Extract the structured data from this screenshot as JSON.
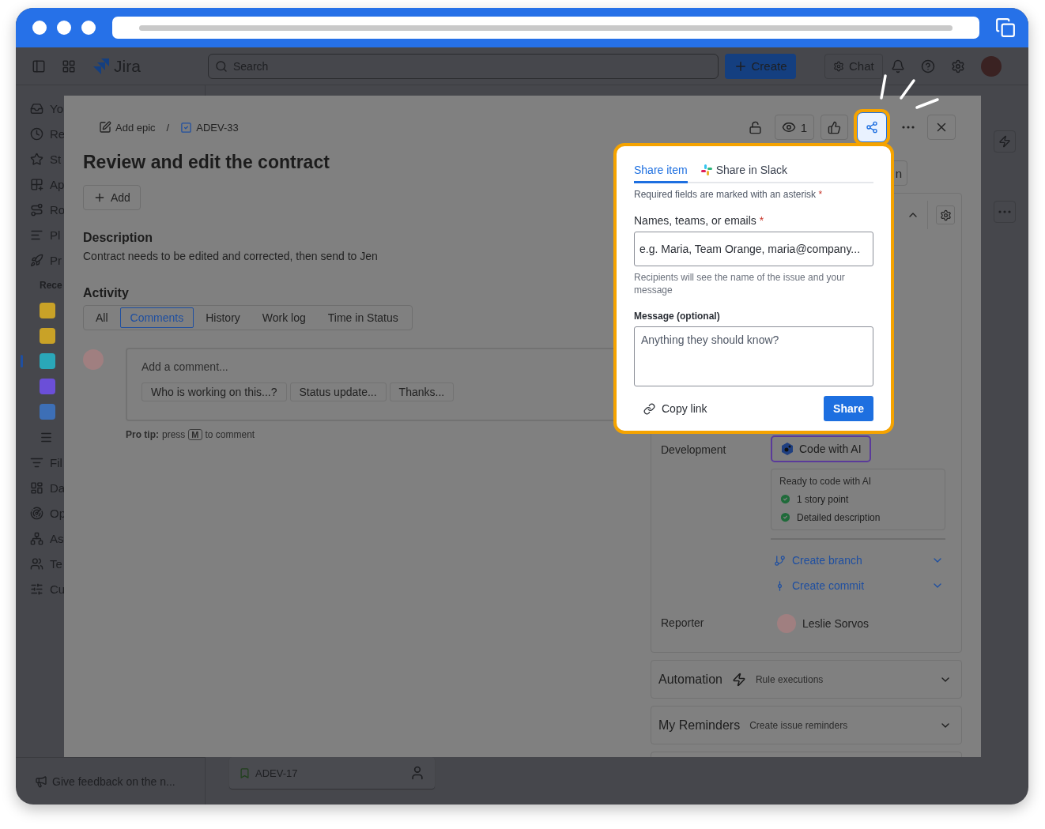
{
  "topbar": {
    "product": "Jira",
    "search_placeholder": "Search",
    "create_label": "Create",
    "chat_label": "Chat"
  },
  "sidebar": {
    "items": [
      {
        "label": "Yo"
      },
      {
        "label": "Re"
      },
      {
        "label": "St"
      },
      {
        "label": "Ap"
      },
      {
        "label": "Ro"
      },
      {
        "label": "Pl"
      },
      {
        "label": "Pr"
      }
    ],
    "recent_heading": "Rece",
    "recent": [
      {
        "kind": "project",
        "color": "#c9a227",
        "selected": false
      },
      {
        "kind": "project",
        "color": "#c9a227",
        "selected": false
      },
      {
        "kind": "project",
        "color": "#2aa7b8",
        "selected": true
      },
      {
        "kind": "project",
        "color": "#6b4fd8",
        "selected": false
      },
      {
        "kind": "project",
        "color": "#3d6fb6",
        "selected": false
      },
      {
        "kind": "view",
        "selected": false
      }
    ],
    "more": [
      {
        "label": "Fil"
      },
      {
        "label": "Da"
      },
      {
        "label": "Op"
      },
      {
        "label": "As"
      },
      {
        "label": "Te"
      },
      {
        "label": "Cu"
      }
    ],
    "feedback": "Give feedback on the n..."
  },
  "board": {
    "card_key": "ADEV-17"
  },
  "modal": {
    "breadcrumb": [
      {
        "kind": "epic",
        "label": "Add epic"
      },
      {
        "kind": "task",
        "label": "ADEV-33"
      }
    ],
    "breadcrumb_separator": "/",
    "watchers": "1",
    "share_selected": true,
    "title": "Review and edit the contract",
    "add_label": "Add",
    "description": {
      "heading": "Description",
      "text": "Contract needs to be edited and corrected, then send to Jen"
    },
    "activity": {
      "heading": "Activity",
      "tabs": [
        {
          "label": "All",
          "selected": false
        },
        {
          "label": "Comments",
          "selected": true
        },
        {
          "label": "History",
          "selected": false
        },
        {
          "label": "Work log",
          "selected": false
        },
        {
          "label": "Time in Status",
          "selected": false
        }
      ],
      "comment_placeholder": "Add a comment...",
      "quick_replies": [
        "Who is working on this...?",
        "Status update...",
        "Thanks..."
      ],
      "pro_tip": {
        "lead": "Pro tip:",
        "before": "press",
        "key": "M",
        "after": "to comment"
      }
    },
    "details": {
      "hidden_button_tail": "n",
      "development": {
        "label": "Development",
        "code_with_ai": "Code with AI",
        "readiness_title": "Ready to code with AI",
        "checks": [
          {
            "label": "1 story point",
            "done": true
          },
          {
            "label": "Detailed description",
            "done": true
          }
        ],
        "actions": [
          {
            "kind": "branch",
            "label": "Create branch"
          },
          {
            "kind": "commit",
            "label": "Create commit"
          }
        ]
      },
      "reporter": {
        "label": "Reporter",
        "name": "Leslie Sorvos"
      }
    },
    "automation": {
      "title": "Automation",
      "subtitle": "Rule executions"
    },
    "reminders": {
      "title": "My Reminders",
      "subtitle": "Create issue reminders"
    }
  },
  "share_popover": {
    "tabs": [
      {
        "kind": "item",
        "label": "Share item",
        "selected": true
      },
      {
        "kind": "slack",
        "label": "Share in Slack",
        "selected": false
      }
    ],
    "required_note": "Required fields are marked with an asterisk",
    "asterisk": "*",
    "recipients": {
      "label": "Names, teams, or emails",
      "required": true,
      "placeholder": "e.g. Maria, Team Orange, maria@company..."
    },
    "helper": "Recipients will see the name of the issue and your message",
    "message": {
      "label": "Message (optional)",
      "placeholder": "Anything they should know?"
    },
    "copy_link": "Copy link",
    "submit": "Share"
  }
}
